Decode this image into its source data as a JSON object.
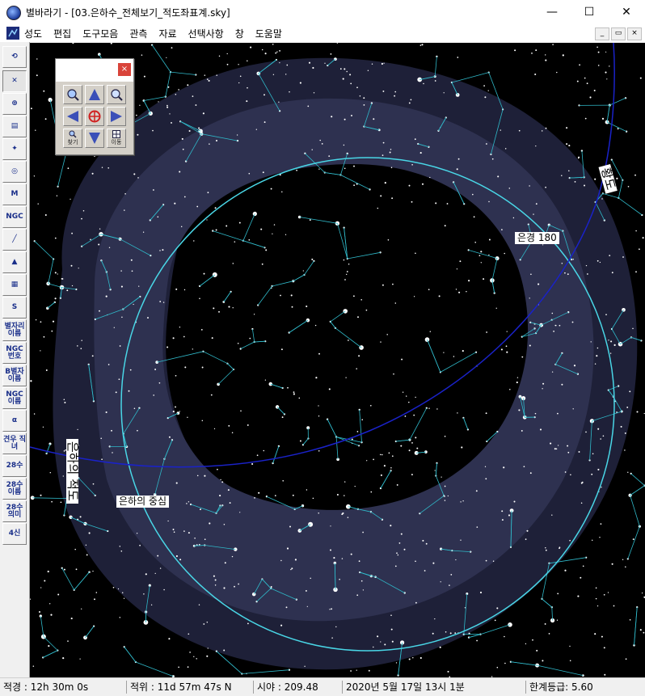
{
  "window": {
    "title": "별바라기 - [03.은하수_전체보기_적도좌표계.sky]",
    "minimize": "—",
    "maximize": "☐",
    "close": "✕"
  },
  "menu": {
    "items": [
      "성도",
      "편집",
      "도구모음",
      "관측",
      "자료",
      "선택사항",
      "창",
      "도움말"
    ],
    "mdi": [
      "_",
      "▭",
      "×"
    ]
  },
  "toolbar": {
    "items": [
      {
        "label": "⟲",
        "name": "pan-tool"
      },
      {
        "label": "✕",
        "name": "select-tool"
      },
      {
        "label": "⊕",
        "name": "globe-tool"
      },
      {
        "label": "▤",
        "name": "layers-tool"
      },
      {
        "label": "✦",
        "name": "star-field-tool"
      },
      {
        "label": "◎",
        "name": "planet-tool"
      },
      {
        "label": "M",
        "name": "messier-tool"
      },
      {
        "label": "NGC",
        "name": "ngc-tool"
      },
      {
        "label": "╱",
        "name": "line-tool"
      },
      {
        "label": "▲",
        "name": "nebula-tool"
      },
      {
        "label": "▦",
        "name": "milkyway-tool"
      },
      {
        "label": "S",
        "name": "curve-tool"
      },
      {
        "label": "별자리 이름",
        "name": "constellation-names-tool"
      },
      {
        "label": "NGC 번호",
        "name": "ngc-numbers-tool"
      },
      {
        "label": "B별자 이름",
        "name": "bayer-names-tool"
      },
      {
        "label": "NGC 이름",
        "name": "ngc-names-tool"
      },
      {
        "label": "α",
        "name": "alpha-tool"
      },
      {
        "label": "견우 직녀",
        "name": "altair-vega-tool"
      },
      {
        "label": "28수",
        "name": "lunar-mansions-tool"
      },
      {
        "label": "28수 이름",
        "name": "lunar-mansions-names-tool"
      },
      {
        "label": "28수 의미",
        "name": "lunar-mansions-meaning-tool"
      },
      {
        "label": "4신",
        "name": "four-gods-tool"
      }
    ]
  },
  "nav_panel": {
    "close": "×",
    "search_label": "찾기",
    "move_label": "이동"
  },
  "sky": {
    "label_galactic_lon": "은경 180",
    "label_galactic_equator": "은하의 적도",
    "label_galactic_center": "은하의 중심",
    "label_ecliptic": "황도",
    "colors": {
      "background": "#000000",
      "milkyway_outer": "#1e2038",
      "milkyway_inner": "#2e3150",
      "constellation_lines": "#2fb8c8",
      "galactic_equator": "#49d6e6",
      "ecliptic": "#1a22c8",
      "stars": "#ffffff"
    }
  },
  "status": {
    "ra": "적경 : 12h 30m  0s",
    "dec": "적위 : 11d 57m 47s N",
    "fov": "시야 : 209.48",
    "datetime": "2020년  5월 17일 13시  1분",
    "limit_mag": "한계등급:  5.60"
  }
}
